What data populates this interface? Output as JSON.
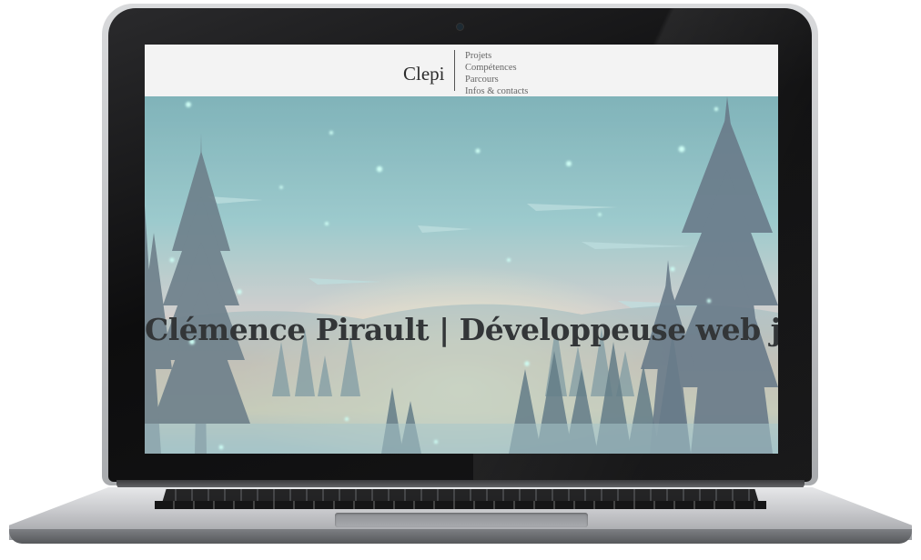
{
  "site": {
    "logo": "Clepi",
    "nav": {
      "items": [
        {
          "label": "Projets"
        },
        {
          "label": "Compétences"
        },
        {
          "label": "Parcours"
        },
        {
          "label": "Infos & contacts"
        }
      ]
    },
    "hero": {
      "title": "Clémence Pirault | Développeuse web junior"
    }
  },
  "colors": {
    "navbar_bg": "#f3f3f3",
    "title_text": "#333638",
    "sky_top": "#7fb3b8",
    "sunset_glow": "#f6c9a0"
  },
  "icons": {
    "camera": "webcam-dot"
  }
}
